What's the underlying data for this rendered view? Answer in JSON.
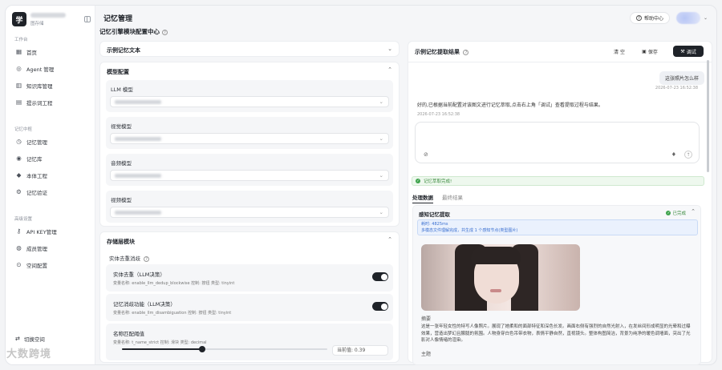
{
  "brand": {
    "logo_char": "学",
    "subtitle": "图存储"
  },
  "sidebar": {
    "groups": [
      {
        "title": "工作台",
        "items": [
          {
            "label": "首页",
            "icon": "grid-icon"
          },
          {
            "label": "Agent 管理",
            "icon": "robot-icon"
          },
          {
            "label": "知识库管理",
            "icon": "book-icon"
          },
          {
            "label": "提示词工程",
            "icon": "document-icon"
          }
        ]
      },
      {
        "title": "记忆中枢",
        "items": [
          {
            "label": "记忆管理",
            "icon": "clock-icon"
          },
          {
            "label": "记忆库",
            "icon": "database-icon"
          },
          {
            "label": "本体工程",
            "icon": "diamond-icon"
          },
          {
            "label": "记忆验证",
            "icon": "gear-icon"
          }
        ]
      },
      {
        "title": "高级设置",
        "items": [
          {
            "label": "API KEY管理",
            "icon": "key-icon"
          },
          {
            "label": "成员管理",
            "icon": "users-icon"
          },
          {
            "label": "空间配置",
            "icon": "settings-icon"
          }
        ]
      }
    ],
    "bottom": {
      "switch_space": "切换空间"
    }
  },
  "header": {
    "title": "记忆管理",
    "help": "帮助中心"
  },
  "section_title": "记忆引擎模块配置中心",
  "left": {
    "sample_text_title": "示例记忆文本",
    "model_config": {
      "title": "模型配置",
      "fields": [
        {
          "label": "LLM 模型"
        },
        {
          "label": "视觉模型"
        },
        {
          "label": "音频模型"
        },
        {
          "label": "视频模型"
        }
      ]
    },
    "storage": {
      "title": "存储层模块",
      "dedup_title": "实体去重消歧",
      "toggles": [
        {
          "title": "实体去重（LLM决策）",
          "meta": "变量名称: enable_llm_dedup_blockwise  控制: 按钮  类型: tinyint",
          "on": true
        },
        {
          "title": "记忆消歧功能（LLM决策）",
          "meta": "变量名称: enable_llm_disambiguation  控制: 按钮  类型: tinyint",
          "on": true
        }
      ],
      "threshold": {
        "title": "名称匹配阈值",
        "meta": "变量名称: t_name_strict  控制: 滑块  类型: decimal",
        "value_label": "当前值: 0.39",
        "value": 0.39
      }
    }
  },
  "right": {
    "title": "示例记忆提取结果",
    "buttons": {
      "clear": "清 空",
      "save": "保存",
      "debug": "调试"
    },
    "user_message": "这张照片怎么样",
    "user_time": "2026-07-23 16:52:38",
    "assistant_message": "好的,已根据当前配置对该图文进行记忆萃取,点击右上角「调试」查看提取过程与结果。",
    "assistant_time": "2026-07-23 16:52:38",
    "success": "记忆萃取完成!",
    "tabs": [
      "处理数据",
      "最终结果"
    ],
    "perception": {
      "title": "感知记忆提取",
      "status": "已完成",
      "info_line1": "耗时: 4825ms",
      "info_line2": "多模态文件理解完成，共生成 1 个感知节点(类型图片)",
      "summary_label": "摘要",
      "summary": "这是一张年轻女性的特写人像照片。展现了她柔和的面部特征和深色长发。画面右侧有强烈的自然光射入，在发丝间形成明显的光晕和过曝效果，营造出梦幻且朦胧的氛围。人物身穿白色吊带衣物，表情平静自然，直视镜头。整体构图简洁，背景为纯净的暖色调墙面，突出了光影对人像情绪的渲染。",
      "topic_label": "主题"
    }
  },
  "watermark": "大数跨境",
  "colors": {
    "accent": "#1f2329",
    "success": "#3fa34d",
    "info": "#3a6fd0"
  }
}
